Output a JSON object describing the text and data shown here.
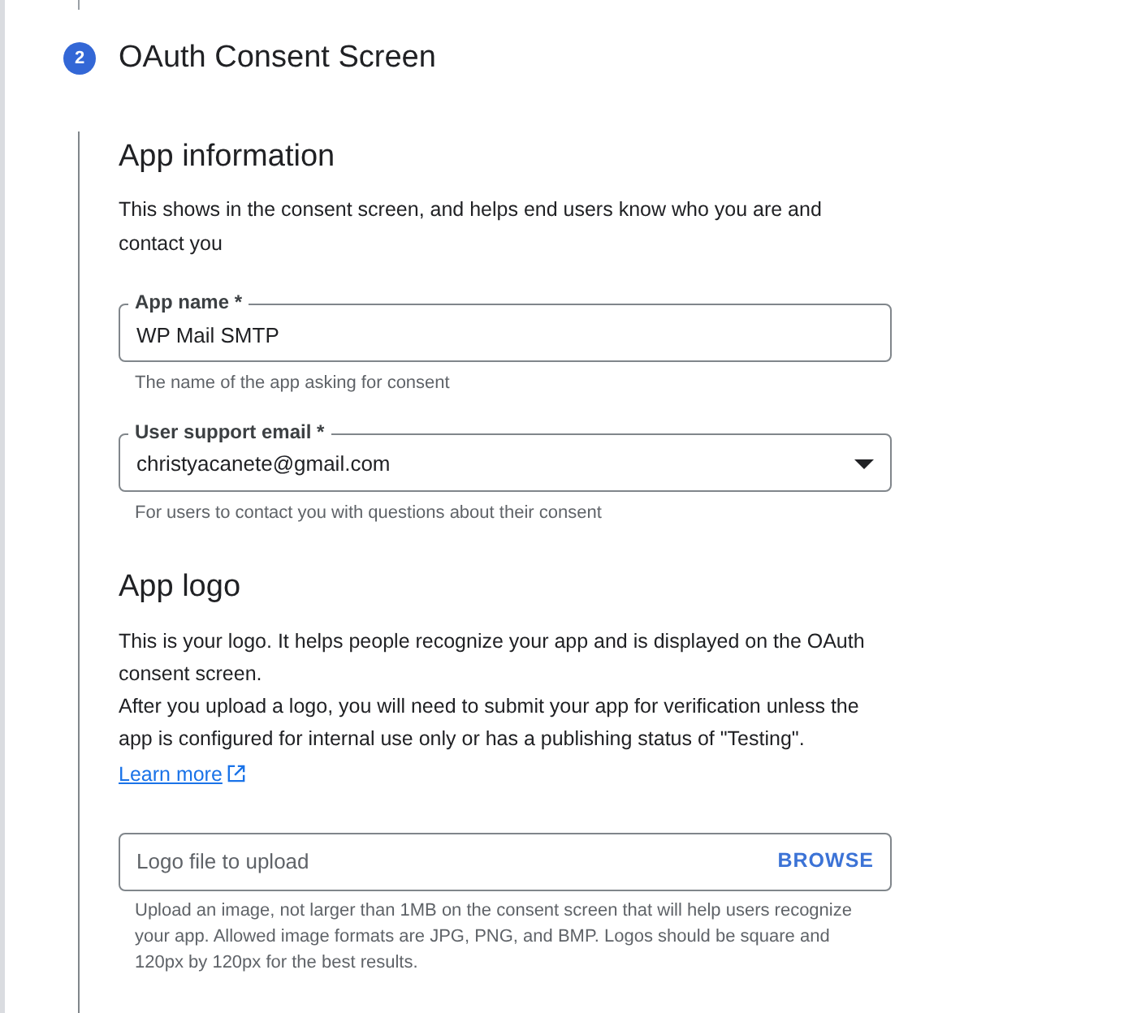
{
  "step": {
    "number": "2",
    "title": "OAuth Consent Screen"
  },
  "app_information": {
    "heading": "App information",
    "description": "This shows in the consent screen, and helps end users know who you are and contact you",
    "fields": [
      {
        "kind": "text",
        "label": "App name *",
        "value": "WP Mail SMTP",
        "hint": "The name of the app asking for consent"
      },
      {
        "kind": "select",
        "label": "User support email *",
        "value": "christyacanete@gmail.com",
        "hint": "For users to contact you with questions about their consent"
      }
    ]
  },
  "app_logo": {
    "heading": "App logo",
    "paragraphs": [
      "This is your logo. It helps people recognize your app and is displayed on the OAuth consent screen.",
      "After you upload a logo, you will need to submit your app for verification unless the app is configured for internal use only or has a publishing status of \"Testing\"."
    ],
    "link": "Learn more",
    "upload": {
      "placeholder": "Logo file to upload",
      "button": "BROWSE",
      "hint": "Upload an image, not larger than 1MB on the consent screen that will help users recognize your app. Allowed image formats are JPG, PNG, and BMP. Logos should be square and 120px by 120px for the best results."
    }
  }
}
